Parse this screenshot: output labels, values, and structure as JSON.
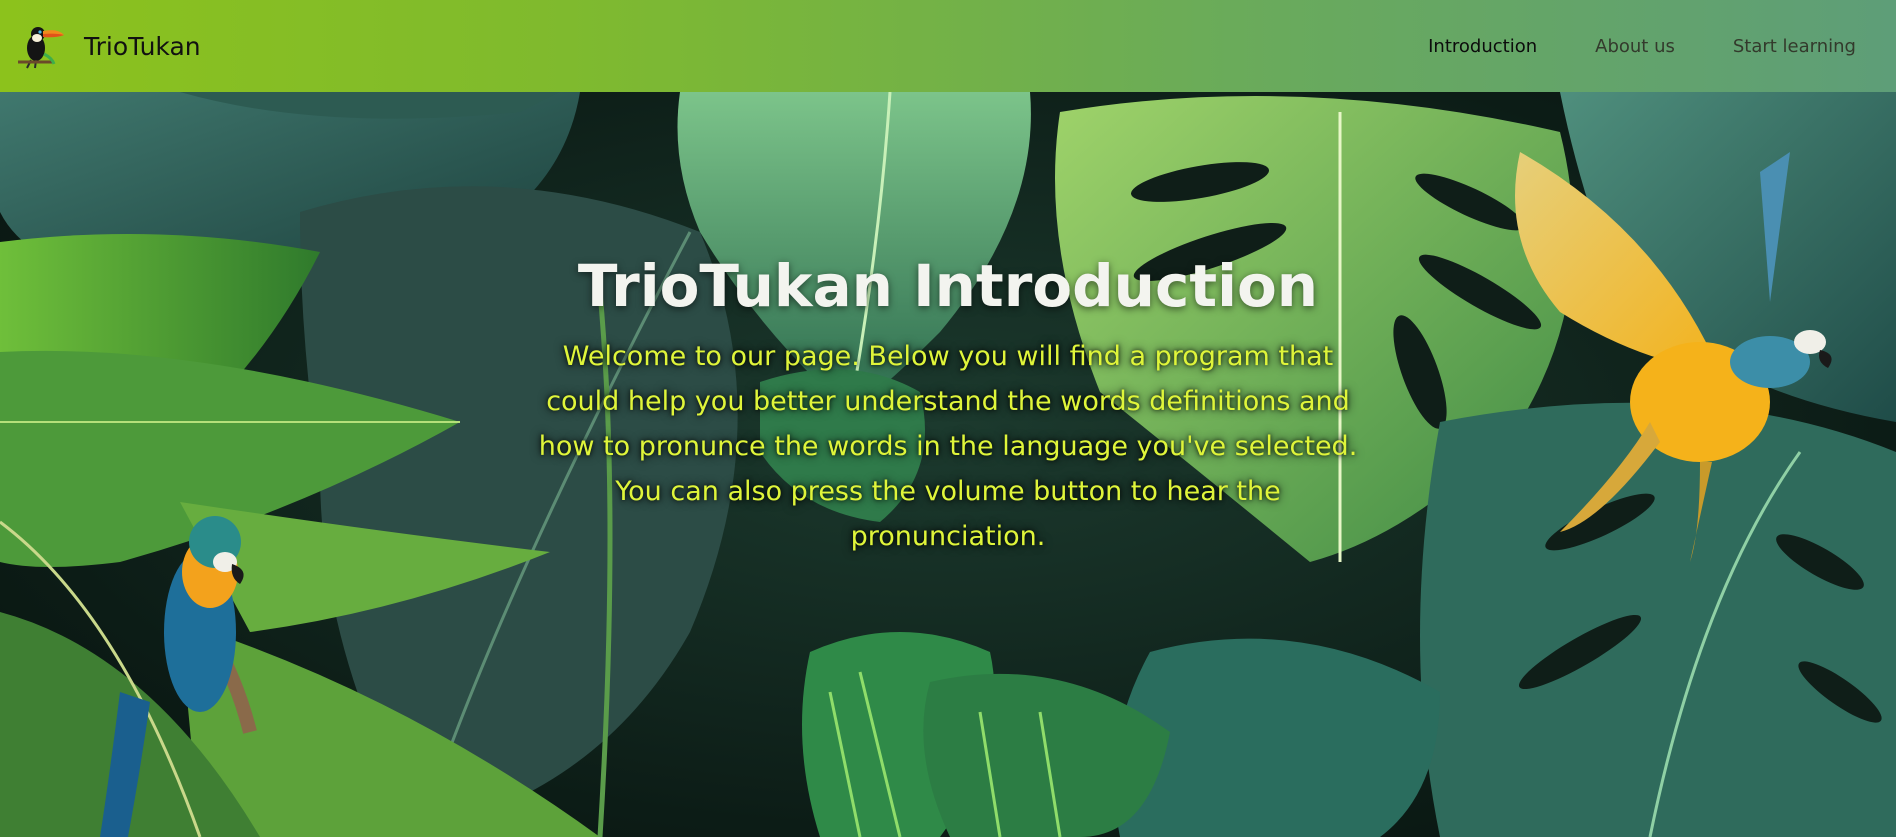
{
  "brand": {
    "name": "TrioTukan",
    "logo_icon": "toucan-icon"
  },
  "nav": {
    "items": [
      {
        "label": "Introduction",
        "active": true
      },
      {
        "label": "About us",
        "active": false
      },
      {
        "label": "Start learning",
        "active": false
      }
    ]
  },
  "hero": {
    "title": "TrioTukan Introduction",
    "body": "Welcome to our page. Below you will find a program that could help you better understand the words definitions and how to pronunce the words in the language you've selected. You can also press the volume button to hear the pronunciation.",
    "background": "tropical-leaves-with-macaws"
  },
  "colors": {
    "nav_start": "#8cc21c",
    "nav_end": "#5e9e78",
    "hero_text": "#dff53a",
    "title_text": "#f3f4ef"
  }
}
